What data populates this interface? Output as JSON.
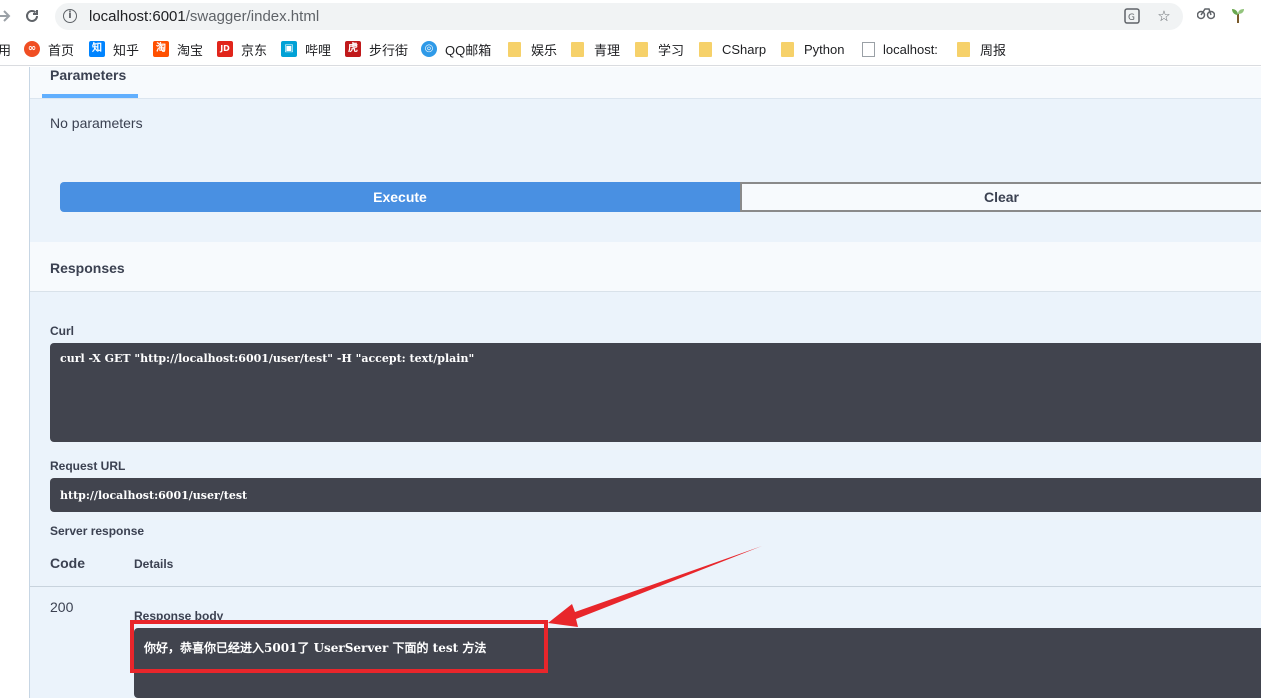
{
  "browser": {
    "url_host": "localhost:6001",
    "url_path": "/swagger/index.html",
    "icons": {
      "forward": "forward-arrow-icon",
      "reload": "reload-icon",
      "info": "info-icon",
      "translate": "translate-icon",
      "star": "star-icon",
      "extension": "extension-icon",
      "plant": "plant-extension-icon"
    },
    "bookmarks_partial": "用",
    "bookmarks": [
      {
        "label": "首页",
        "fav": "∞",
        "color": "#f04e23"
      },
      {
        "label": "知乎",
        "fav": "知",
        "color": "#0084ff"
      },
      {
        "label": "淘宝",
        "fav": "淘",
        "color": "#ff5000"
      },
      {
        "label": "京东",
        "fav": "JD",
        "color": "#e1251b"
      },
      {
        "label": "哔哩",
        "fav": "▣",
        "color": "#00a1d6"
      },
      {
        "label": "步行街",
        "fav": "虎",
        "color": "#c0191b"
      },
      {
        "label": "QQ邮箱",
        "fav": "◎",
        "color": "#2f9ae8"
      },
      {
        "label": "娱乐",
        "type": "folder"
      },
      {
        "label": "青理",
        "type": "folder"
      },
      {
        "label": "学习",
        "type": "folder"
      },
      {
        "label": "CSharp",
        "type": "folder"
      },
      {
        "label": "Python",
        "type": "folder"
      },
      {
        "label": "localhost:",
        "type": "doc"
      },
      {
        "label": "周报",
        "type": "folder"
      }
    ]
  },
  "swagger": {
    "parameters_tab": "Parameters",
    "no_parameters": "No parameters",
    "execute_label": "Execute",
    "clear_label": "Clear",
    "responses_title": "Responses",
    "curl_label": "Curl",
    "curl_command": "curl -X GET \"http://localhost:6001/user/test\" -H \"accept: text/plain\"",
    "request_url_label": "Request URL",
    "request_url": "http://localhost:6001/user/test",
    "server_response_label": "Server response",
    "code_header": "Code",
    "details_header": "Details",
    "status_code": "200",
    "response_body_label": "Response body",
    "response_body": "你好，恭喜你已经进入5001了 UserServer 下面的 test 方法"
  },
  "annotation": {
    "color": "#e8262b"
  },
  "colors": {
    "execute": "#4990e2",
    "opblock_bg": "#ebf3fb",
    "code_bg": "#41444e",
    "tab_underline": "#61affe"
  }
}
